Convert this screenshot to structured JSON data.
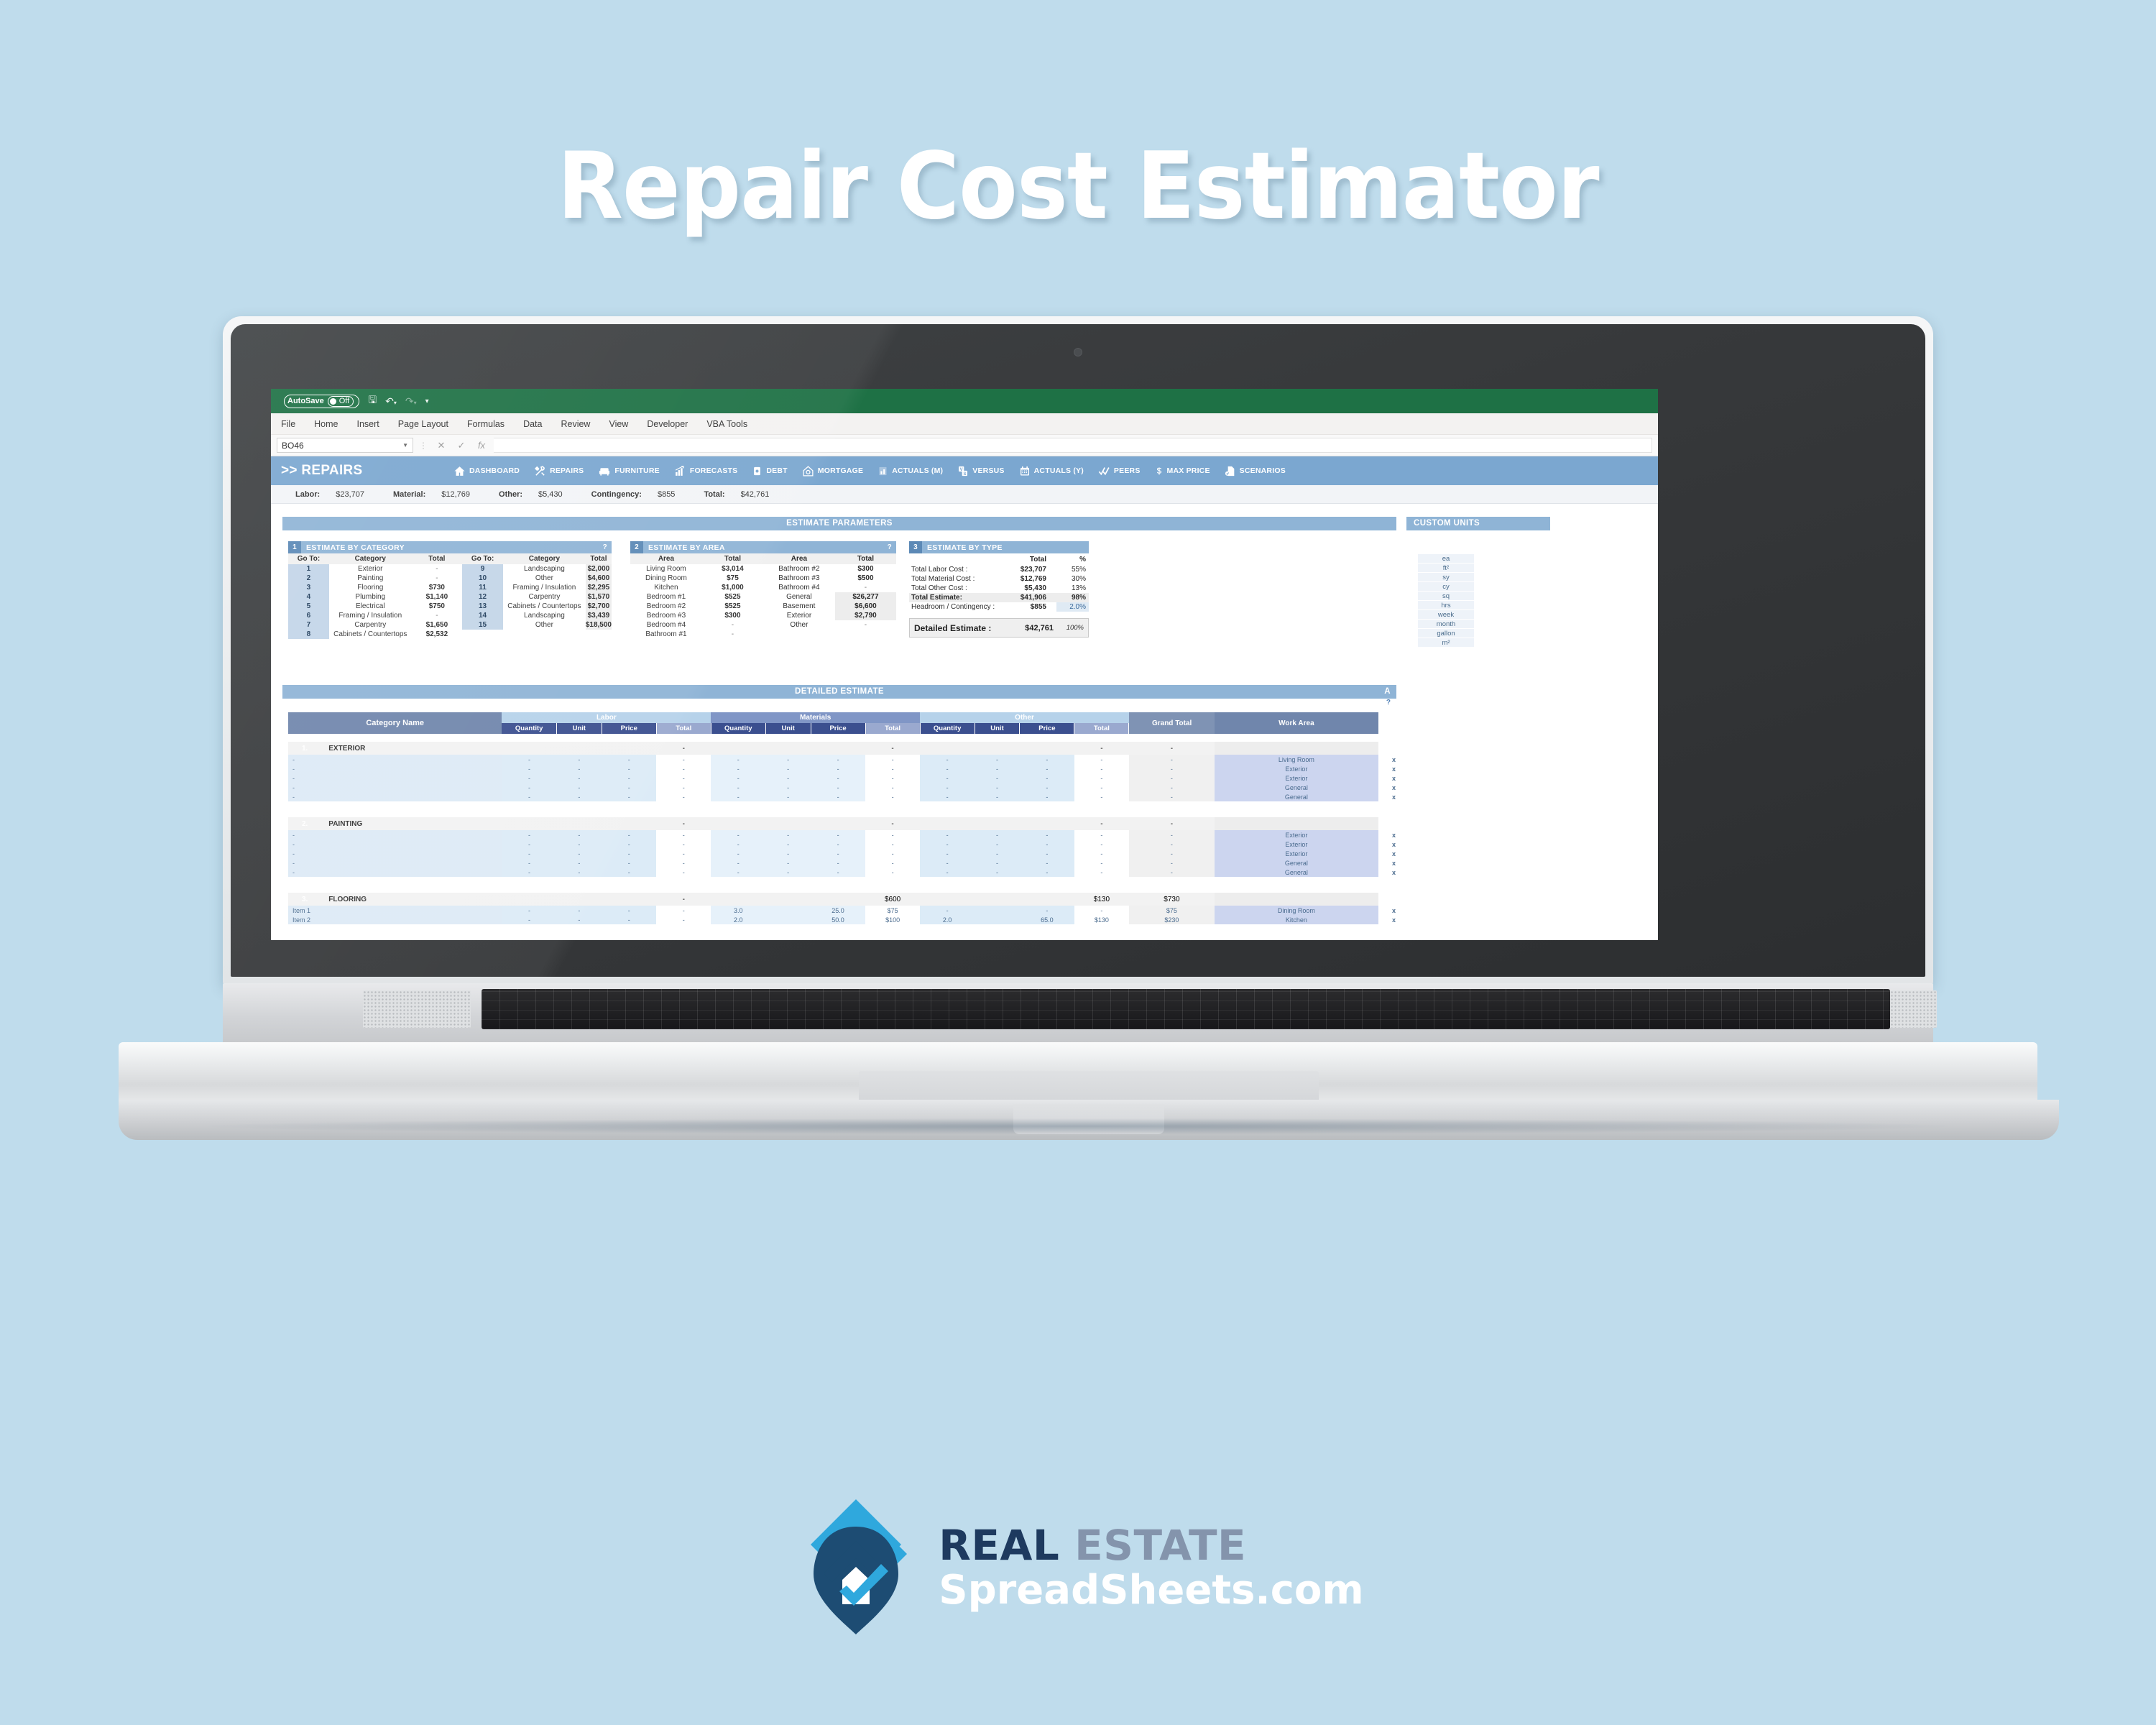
{
  "hero": {
    "title": "Repair Cost Estimator"
  },
  "excel": {
    "autosave_label": "AutoSave",
    "autosave_state": "Off",
    "ribbon_tabs": [
      "File",
      "Home",
      "Insert",
      "Page Layout",
      "Formulas",
      "Data",
      "Review",
      "View",
      "Developer",
      "VBA Tools"
    ],
    "name_box": "BO46",
    "formula_value": ""
  },
  "nav": {
    "title": ">> REPAIRS",
    "items": [
      {
        "label": "DASHBOARD",
        "icon": "home-icon"
      },
      {
        "label": "REPAIRS",
        "icon": "tools-icon"
      },
      {
        "label": "FURNITURE",
        "icon": "sofa-icon"
      },
      {
        "label": "FORECASTS",
        "icon": "bar-chart-up-icon"
      },
      {
        "label": "DEBT",
        "icon": "money-roll-icon"
      },
      {
        "label": "MORTGAGE",
        "icon": "house-percent-icon"
      },
      {
        "label": "ACTUALS (M)",
        "icon": "bar-chart-icon"
      },
      {
        "label": "VERSUS",
        "icon": "versus-icon"
      },
      {
        "label": "ACTUALS (Y)",
        "icon": "calendar-icon"
      },
      {
        "label": "PEERS",
        "icon": "check-check-icon"
      },
      {
        "label": "MAX PRICE",
        "icon": "dollar-icon"
      },
      {
        "label": "SCENARIOS",
        "icon": "document-check-icon"
      }
    ]
  },
  "summary": [
    {
      "label": "Labor:",
      "value": "$23,707"
    },
    {
      "label": "Material:",
      "value": "$12,769"
    },
    {
      "label": "Other:",
      "value": "$5,430"
    },
    {
      "label": "Contingency:",
      "value": "$855"
    },
    {
      "label": "Total:",
      "value": "$42,761"
    }
  ],
  "bands": {
    "estimate_parameters": "ESTIMATE PARAMETERS",
    "custom_units": "CUSTOM UNITS",
    "detailed_estimate": "DETAILED ESTIMATE",
    "detailed_estimate_a": "A",
    "detailed_estimate_help": "?"
  },
  "panel_category": {
    "number": "1",
    "title": "ESTIMATE BY CATEGORY",
    "help": "?",
    "headers": [
      "Go To:",
      "Category",
      "Total",
      "Go To:",
      "Category",
      "Total"
    ],
    "rows": [
      {
        "n1": "1",
        "cat1": "Exterior",
        "tot1": "-",
        "t1style": "none",
        "n2": "9",
        "cat2": "Landscaping",
        "tot2": "$2,000",
        "t2style": "grey"
      },
      {
        "n1": "2",
        "cat1": "Painting",
        "tot1": "-",
        "t1style": "none",
        "n2": "10",
        "cat2": "Other",
        "tot2": "$4,600",
        "t2style": "grey"
      },
      {
        "n1": "3",
        "cat1": "Flooring",
        "tot1": "$730",
        "t1style": "white",
        "n2": "11",
        "cat2": "Framing / Insulation",
        "tot2": "$2,295",
        "t2style": "grey"
      },
      {
        "n1": "4",
        "cat1": "Plumbing",
        "tot1": "$1,140",
        "t1style": "white",
        "n2": "12",
        "cat2": "Carpentry",
        "tot2": "$1,570",
        "t2style": "grey"
      },
      {
        "n1": "5",
        "cat1": "Electrical",
        "tot1": "$750",
        "t1style": "white",
        "n2": "13",
        "cat2": "Cabinets / Countertops",
        "tot2": "$2,700",
        "t2style": "grey"
      },
      {
        "n1": "6",
        "cat1": "Framing / Insulation",
        "tot1": "-",
        "t1style": "none",
        "n2": "14",
        "cat2": "Landscaping",
        "tot2": "$3,439",
        "t2style": "grey"
      },
      {
        "n1": "7",
        "cat1": "Carpentry",
        "tot1": "$1,650",
        "t1style": "white",
        "n2": "15",
        "cat2": "Other",
        "tot2": "$18,500",
        "t2style": "greyfull"
      },
      {
        "n1": "8",
        "cat1": "Cabinets / Countertops",
        "tot1": "$2,532",
        "t1style": "white",
        "n2": "",
        "cat2": "",
        "tot2": "",
        "t2style": "empty"
      }
    ]
  },
  "panel_area": {
    "number": "2",
    "title": "ESTIMATE BY AREA",
    "help": "?",
    "headers": [
      "Area",
      "Total",
      "Area",
      "Total"
    ],
    "rows": [
      {
        "a1": "Living Room",
        "t1": "$3,014",
        "s1": "white",
        "a2": "Bathroom #2",
        "t2": "$300",
        "s2": "white"
      },
      {
        "a1": "Dining Room",
        "t1": "$75",
        "s1": "white",
        "a2": "Bathroom #3",
        "t2": "$500",
        "s2": "white"
      },
      {
        "a1": "Kitchen",
        "t1": "$1,000",
        "s1": "white",
        "a2": "Bathroom #4",
        "t2": "-",
        "s2": "none"
      },
      {
        "a1": "Bedroom #1",
        "t1": "$525",
        "s1": "white",
        "a2": "General",
        "t2": "$26,277",
        "s2": "grey"
      },
      {
        "a1": "Bedroom #2",
        "t1": "$525",
        "s1": "white",
        "a2": "Basement",
        "t2": "$6,600",
        "s2": "grey"
      },
      {
        "a1": "Bedroom #3",
        "t1": "$300",
        "s1": "white",
        "a2": "Exterior",
        "t2": "$2,790",
        "s2": "grey"
      },
      {
        "a1": "Bedroom #4",
        "t1": "-",
        "s1": "none",
        "a2": "Other",
        "t2": "-",
        "s2": "none"
      },
      {
        "a1": "Bathroom #1",
        "t1": "-",
        "s1": "none",
        "a2": "",
        "t2": "",
        "s2": "empty"
      }
    ]
  },
  "panel_type": {
    "number": "3",
    "title": "ESTIMATE BY TYPE",
    "headers": [
      "",
      "Total",
      "%"
    ],
    "rows": [
      {
        "label": "Total Labor Cost :",
        "total": "$23,707",
        "pct": "55%",
        "emph": false
      },
      {
        "label": "Total Material Cost :",
        "total": "$12,769",
        "pct": "30%",
        "emph": false
      },
      {
        "label": "Total Other Cost :",
        "total": "$5,430",
        "pct": "13%",
        "emph": false
      },
      {
        "label": "Total Estimate:",
        "total": "$41,906",
        "pct": "98%",
        "emph": true
      },
      {
        "label": "Headroom / Contingency :",
        "total": "$855",
        "pct": "2.0%",
        "emph": false
      }
    ],
    "footer": {
      "label": "Detailed Estimate  :",
      "total": "$42,761",
      "pct": "100%"
    }
  },
  "custom_units": [
    "ea",
    "ft²",
    "sy",
    "cy",
    "sq",
    "hrs",
    "week",
    "month",
    "gallon",
    "m²"
  ],
  "detailed": {
    "col_category": "Category Name",
    "groups": [
      {
        "name": "Labor",
        "style": "light"
      },
      {
        "name": "Materials",
        "style": "dark"
      },
      {
        "name": "Other",
        "style": "light"
      }
    ],
    "sub_headers": [
      "Quantity",
      "Unit",
      "Price",
      "Total"
    ],
    "col_grand_total": "Grand Total",
    "col_work_area": "Work Area",
    "sections": [
      {
        "num": "1.",
        "name": "EXTERIOR",
        "labor_total": "-",
        "materials_total": "-",
        "other_total": "-",
        "grand_total": "-",
        "work_area": "",
        "rows": [
          {
            "name": "-",
            "lq": "-",
            "lu": "-",
            "lp": "-",
            "lt": "-",
            "mq": "-",
            "mu": "-",
            "mp": "-",
            "mt": "-",
            "oq": "-",
            "ou": "-",
            "op": "-",
            "ot": "-",
            "gt": "-",
            "wa": "Living Room",
            "x": "x"
          },
          {
            "name": "-",
            "lq": "-",
            "lu": "-",
            "lp": "-",
            "lt": "-",
            "mq": "-",
            "mu": "-",
            "mp": "-",
            "mt": "-",
            "oq": "-",
            "ou": "-",
            "op": "-",
            "ot": "-",
            "gt": "-",
            "wa": "Exterior",
            "x": "x"
          },
          {
            "name": "-",
            "lq": "-",
            "lu": "-",
            "lp": "-",
            "lt": "-",
            "mq": "-",
            "mu": "-",
            "mp": "-",
            "mt": "-",
            "oq": "-",
            "ou": "-",
            "op": "-",
            "ot": "-",
            "gt": "-",
            "wa": "Exterior",
            "x": "x"
          },
          {
            "name": "-",
            "lq": "-",
            "lu": "-",
            "lp": "-",
            "lt": "-",
            "mq": "-",
            "mu": "-",
            "mp": "-",
            "mt": "-",
            "oq": "-",
            "ou": "-",
            "op": "-",
            "ot": "-",
            "gt": "-",
            "wa": "General",
            "x": "x"
          },
          {
            "name": "-",
            "lq": "-",
            "lu": "-",
            "lp": "-",
            "lt": "-",
            "mq": "-",
            "mu": "-",
            "mp": "-",
            "mt": "-",
            "oq": "-",
            "ou": "-",
            "op": "-",
            "ot": "-",
            "gt": "-",
            "wa": "General",
            "x": "x"
          }
        ]
      },
      {
        "num": "2.",
        "name": "PAINTING",
        "labor_total": "-",
        "materials_total": "-",
        "other_total": "-",
        "grand_total": "-",
        "work_area": "",
        "rows": [
          {
            "name": "-",
            "lq": "-",
            "lu": "-",
            "lp": "-",
            "lt": "-",
            "mq": "-",
            "mu": "-",
            "mp": "-",
            "mt": "-",
            "oq": "-",
            "ou": "-",
            "op": "-",
            "ot": "-",
            "gt": "-",
            "wa": "Exterior",
            "x": "x"
          },
          {
            "name": "-",
            "lq": "-",
            "lu": "-",
            "lp": "-",
            "lt": "-",
            "mq": "-",
            "mu": "-",
            "mp": "-",
            "mt": "-",
            "oq": "-",
            "ou": "-",
            "op": "-",
            "ot": "-",
            "gt": "-",
            "wa": "Exterior",
            "x": "x"
          },
          {
            "name": "-",
            "lq": "-",
            "lu": "-",
            "lp": "-",
            "lt": "-",
            "mq": "-",
            "mu": "-",
            "mp": "-",
            "mt": "-",
            "oq": "-",
            "ou": "-",
            "op": "-",
            "ot": "-",
            "gt": "-",
            "wa": "Exterior",
            "x": "x"
          },
          {
            "name": "-",
            "lq": "-",
            "lu": "-",
            "lp": "-",
            "lt": "-",
            "mq": "-",
            "mu": "-",
            "mp": "-",
            "mt": "-",
            "oq": "-",
            "ou": "-",
            "op": "-",
            "ot": "-",
            "gt": "-",
            "wa": "General",
            "x": "x"
          },
          {
            "name": "-",
            "lq": "-",
            "lu": "-",
            "lp": "-",
            "lt": "-",
            "mq": "-",
            "mu": "-",
            "mp": "-",
            "mt": "-",
            "oq": "-",
            "ou": "-",
            "op": "-",
            "ot": "-",
            "gt": "-",
            "wa": "General",
            "x": "x"
          }
        ]
      },
      {
        "num": "3.",
        "name": "FLOORING",
        "labor_total": "-",
        "materials_total": "$600",
        "other_total": "$130",
        "grand_total": "$730",
        "work_area": "",
        "rows": [
          {
            "name": "Item 1",
            "lq": "-",
            "lu": "-",
            "lp": "-",
            "lt": "-",
            "mq": "3.0",
            "mu": "",
            "mp": "25.0",
            "mt": "$75",
            "oq": "-",
            "ou": "",
            "op": "-",
            "ot": "-",
            "gt": "$75",
            "wa": "Dining Room",
            "x": "x"
          },
          {
            "name": "Item 2",
            "lq": "-",
            "lu": "-",
            "lp": "-",
            "lt": "-",
            "mq": "2.0",
            "mu": "",
            "mp": "50.0",
            "mt": "$100",
            "oq": "2.0",
            "ou": "",
            "op": "65.0",
            "ot": "$130",
            "gt": "$230",
            "wa": "Kitchen",
            "x": "x"
          }
        ]
      }
    ]
  },
  "brand": {
    "line1_word1": "REAL",
    "line1_word2": "ESTATE",
    "line2": "SpreadSheets.com"
  }
}
